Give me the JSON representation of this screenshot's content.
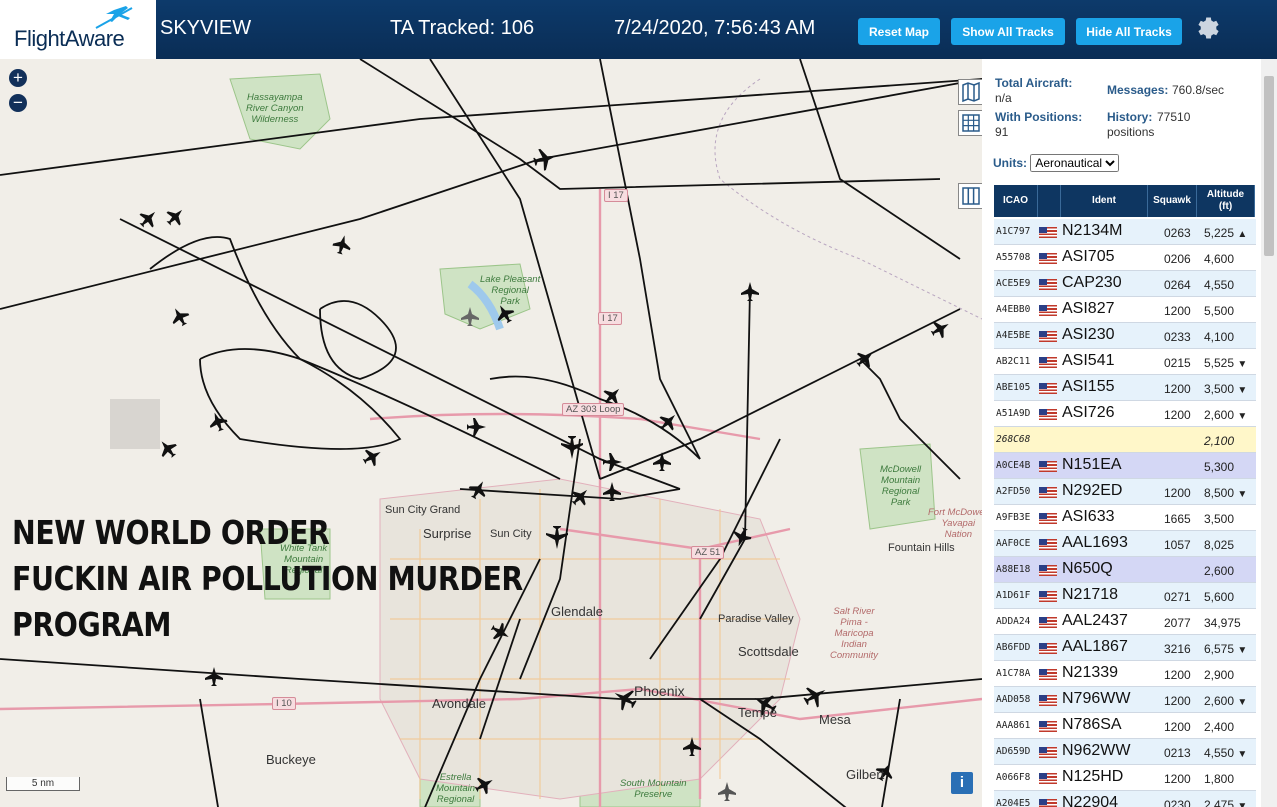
{
  "header": {
    "logo": "FlightAware",
    "site_name": "SKYVIEW",
    "ta_tracked": "TA Tracked: 106",
    "clock": "7/24/2020, 7:56:43 AM",
    "buttons": {
      "reset": "Reset Map",
      "show": "Show All Tracks",
      "hide": "Hide All Tracks"
    },
    "settings_icon": "gear-icon"
  },
  "map": {
    "places": [
      {
        "name": "Surprise"
      },
      {
        "name": "Sun City"
      },
      {
        "name": "Sun City Grand"
      },
      {
        "name": "Glendale"
      },
      {
        "name": "Paradise Valley"
      },
      {
        "name": "Scottsdale"
      },
      {
        "name": "Phoenix"
      },
      {
        "name": "Avondale"
      },
      {
        "name": "Tempe"
      },
      {
        "name": "Mesa"
      },
      {
        "name": "Buckeye"
      },
      {
        "name": "Gilbert"
      },
      {
        "name": "Fountain Hills"
      }
    ],
    "parks": {
      "hassayampa": "Hassayampa\nRiver Canyon\nWilderness",
      "lake_pleasant": "Lake Pleasant\nRegional\nPark",
      "mcdowell": "McDowell\nMountain\nRegional\nPark",
      "fort_mcdowell": "Fort McDowell\nYavapai\nNation",
      "white_tank": "White Tank\nMountain\nRegional",
      "salt_river": "Salt River\nPima -\nMaricopa\nIndian\nCommunity",
      "estrella": "Estrella\nMountain\nRegional",
      "south_mountain": "South Mountain\nPreserve"
    },
    "shields": {
      "i17_top": "I 17",
      "i17": "I 17",
      "az303": "AZ 303 Loop",
      "az51": "AZ 51",
      "i10": "I 10"
    },
    "overlay_text": [
      "NEW WORLD ORDER",
      "FUCKIN AIR POLLUTION MURDER",
      "PROGRAM"
    ],
    "zoom_in": "+",
    "zoom_out": "−",
    "scale": "5 nm",
    "info": "i"
  },
  "panel": {
    "total_aircraft_label": "Total Aircraft:",
    "total_aircraft": "n/a",
    "messages_label": "Messages:",
    "messages": "760.8/sec",
    "with_positions_label": "With Positions:",
    "with_positions": "91",
    "history_label": "History:",
    "history": "77510",
    "history_unit": "positions",
    "units_label": "Units:",
    "units_value": "Aeronautical",
    "columns": {
      "icao": "ICAO",
      "ident": "Ident",
      "squawk": "Squawk",
      "altitude": "Altitude",
      "altitude_unit": "(ft)"
    },
    "rows": [
      {
        "icao": "A1C797",
        "ident": "N2134M",
        "squawk": "0263",
        "alt": "5,225",
        "trend": "▲"
      },
      {
        "icao": "A55708",
        "ident": "ASI705",
        "squawk": "0206",
        "alt": "4,600",
        "trend": ""
      },
      {
        "icao": "ACE5E9",
        "ident": "CAP230",
        "squawk": "0264",
        "alt": "4,550",
        "trend": ""
      },
      {
        "icao": "A4EBB0",
        "ident": "ASI827",
        "squawk": "1200",
        "alt": "5,500",
        "trend": ""
      },
      {
        "icao": "A4E5BE",
        "ident": "ASI230",
        "squawk": "0233",
        "alt": "4,100",
        "trend": ""
      },
      {
        "icao": "AB2C11",
        "ident": "ASI541",
        "squawk": "0215",
        "alt": "5,525",
        "trend": "▼"
      },
      {
        "icao": "ABE105",
        "ident": "ASI155",
        "squawk": "1200",
        "alt": "3,500",
        "trend": "▼"
      },
      {
        "icao": "A51A9D",
        "ident": "ASI726",
        "squawk": "1200",
        "alt": "2,600",
        "trend": "▼"
      },
      {
        "icao": "268C68",
        "ident": "",
        "squawk": "",
        "alt": "2,100",
        "trend": ""
      },
      {
        "icao": "A0CE4B",
        "ident": "N151EA",
        "squawk": "",
        "alt": "5,300",
        "trend": ""
      },
      {
        "icao": "A2FD50",
        "ident": "N292ED",
        "squawk": "1200",
        "alt": "8,500",
        "trend": "▼"
      },
      {
        "icao": "A9FB3E",
        "ident": "ASI633",
        "squawk": "1665",
        "alt": "3,500",
        "trend": ""
      },
      {
        "icao": "AAF0CE",
        "ident": "AAL1693",
        "squawk": "1057",
        "alt": "8,025",
        "trend": ""
      },
      {
        "icao": "A88E18",
        "ident": "N650Q",
        "squawk": "",
        "alt": "2,600",
        "trend": ""
      },
      {
        "icao": "A1D61F",
        "ident": "N21718",
        "squawk": "0271",
        "alt": "5,600",
        "trend": ""
      },
      {
        "icao": "ADDA24",
        "ident": "AAL2437",
        "squawk": "2077",
        "alt": "34,975",
        "trend": ""
      },
      {
        "icao": "AB6FDD",
        "ident": "AAL1867",
        "squawk": "3216",
        "alt": "6,575",
        "trend": "▼"
      },
      {
        "icao": "A1C78A",
        "ident": "N21339",
        "squawk": "1200",
        "alt": "2,900",
        "trend": ""
      },
      {
        "icao": "AAD058",
        "ident": "N796WW",
        "squawk": "1200",
        "alt": "2,600",
        "trend": "▼"
      },
      {
        "icao": "AAA861",
        "ident": "N786SA",
        "squawk": "1200",
        "alt": "2,400",
        "trend": ""
      },
      {
        "icao": "AD659D",
        "ident": "N962WW",
        "squawk": "0213",
        "alt": "4,550",
        "trend": "▼"
      },
      {
        "icao": "A066F8",
        "ident": "N125HD",
        "squawk": "1200",
        "alt": "1,800",
        "trend": ""
      },
      {
        "icao": "A204E5",
        "ident": "N22904",
        "squawk": "0230",
        "alt": "2,475",
        "trend": "▼"
      }
    ]
  }
}
